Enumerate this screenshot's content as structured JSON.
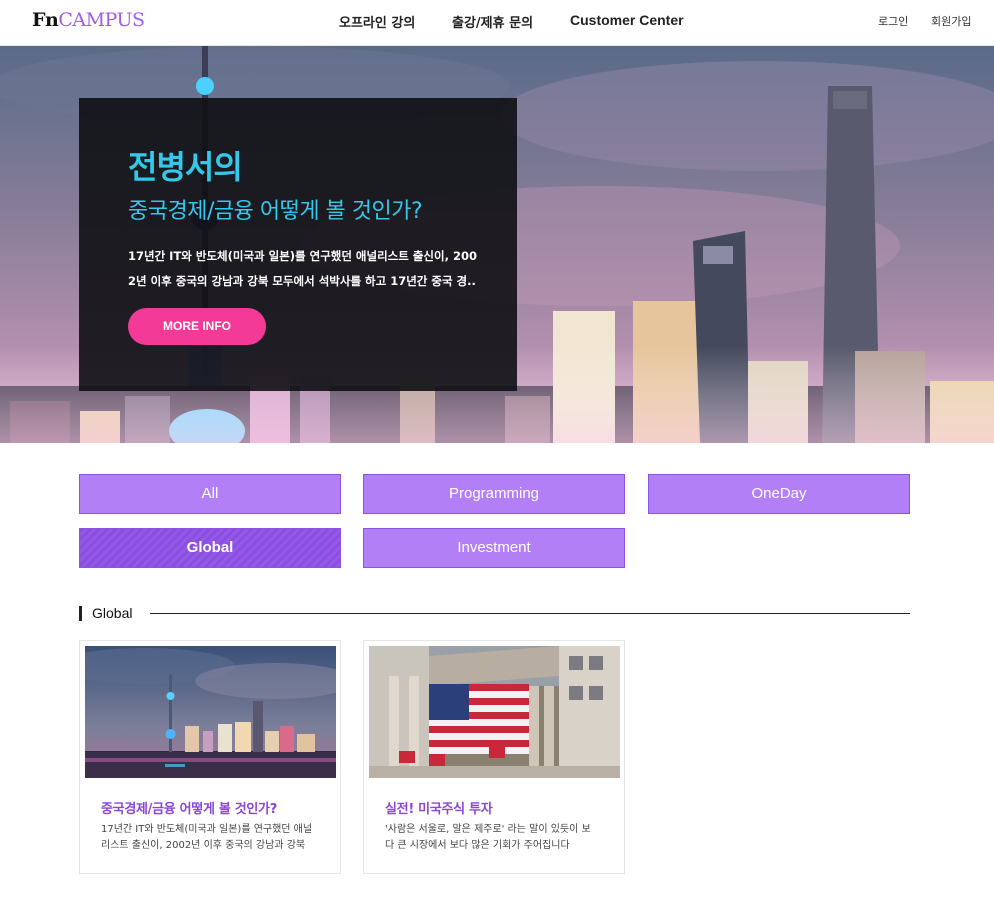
{
  "header": {
    "logo_fn": "Fn",
    "logo_campus": "CAMPUS",
    "nav": [
      "오프라인 강의",
      "출강/제휴 문의",
      "Customer Center"
    ],
    "util": [
      "로그인",
      "회원가입"
    ]
  },
  "hero": {
    "title": "전병서의",
    "subtitle": "중국경제/금융 어떻게 볼 것인가?",
    "desc_line1": "17년간 IT와 반도체(미국과 일본)를 연구했던 애널리스트 출신이, 200",
    "desc_line2": "2년 이후 중국의 강남과 강북 모두에서 석박사를 하고 17년간 중국 경..",
    "button": "MORE INFO"
  },
  "categories": [
    "All",
    "Programming",
    "OneDay",
    "Global",
    "Investment"
  ],
  "active_category": "Global",
  "section": {
    "title": "Global"
  },
  "cards": [
    {
      "title": "중국경제/금융 어떻게 볼 것인가?",
      "desc_line1": "17년간 IT와 반도체(미국과 일본)를 연구했던 애널",
      "desc_line2": "리스트 출신이, 2002년 이후 중국의 강남과 강북"
    },
    {
      "title": "실전! 미국주식 투자",
      "desc_line1": "'사람은 서울로, 말은 제주로' 라는 말이 있듯이 보",
      "desc_line2": "다 큰 시장에서 보다 많은 기회가 주어집니다"
    }
  ],
  "colors": {
    "brand": "#a25ce8",
    "hero_text": "#34c8ea",
    "cta": "#f23a96",
    "category": "#b37ff6",
    "category_active": "#8a4ee0",
    "card_title": "#8b46d8"
  }
}
